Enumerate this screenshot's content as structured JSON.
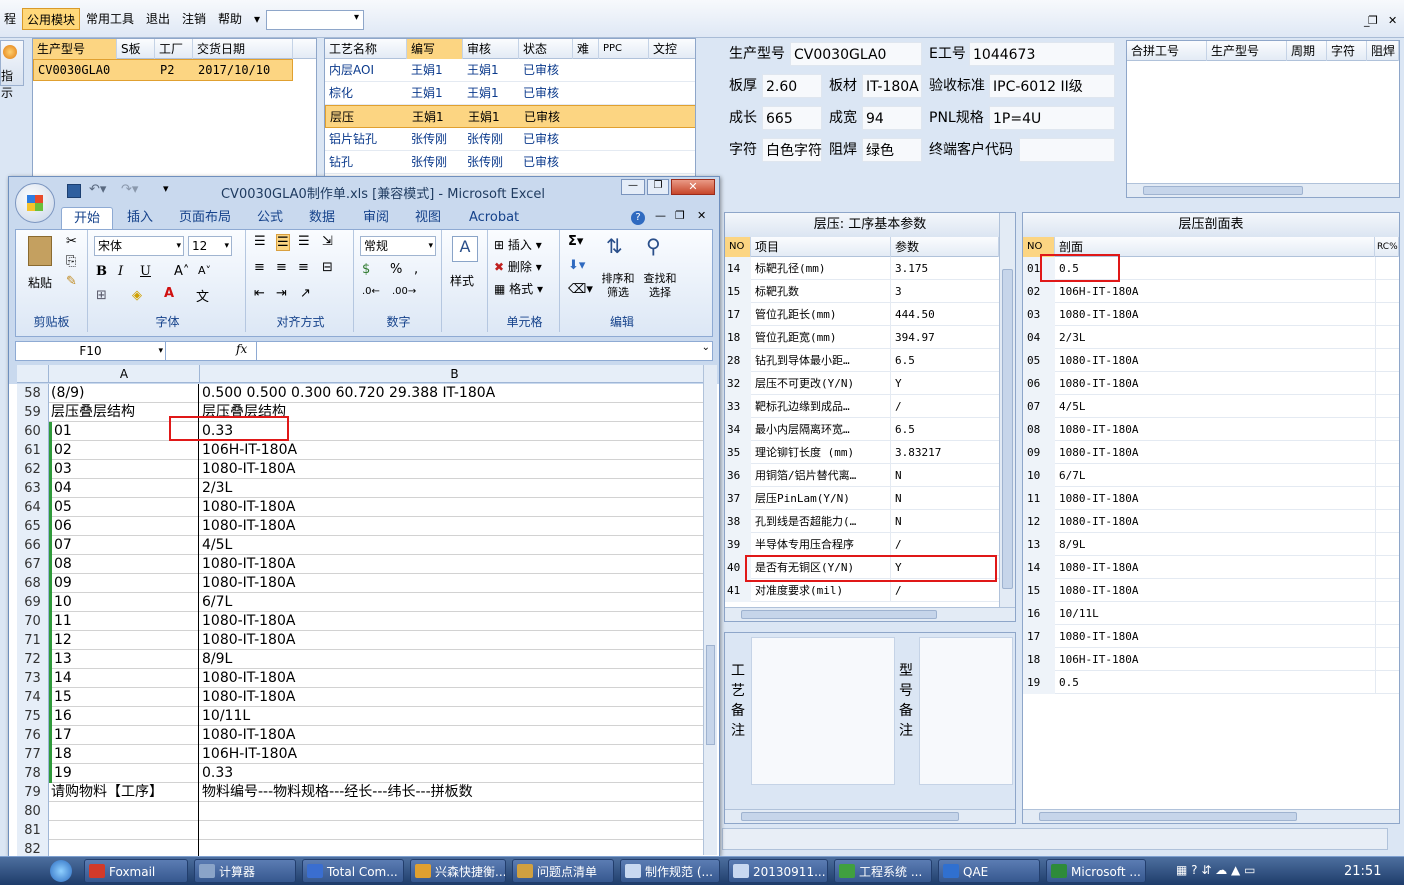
{
  "menu": {
    "items": [
      {
        "label": "程"
      },
      {
        "label": "公用模块"
      },
      {
        "label": "常用工具"
      },
      {
        "label": "退出"
      },
      {
        "label": "注销"
      },
      {
        "label": "帮助"
      }
    ],
    "combo_value": ""
  },
  "left_button_label": "指示",
  "product_table": {
    "headers": [
      "生产型号",
      "S板",
      "工厂",
      "交货日期"
    ],
    "rows": [
      [
        "CV0030GLA0",
        "",
        "P2",
        "2017/10/10"
      ]
    ]
  },
  "process_table": {
    "headers": [
      "工艺名称",
      "编写",
      "审核",
      "状态",
      "难",
      "PPC",
      "文控"
    ],
    "rows": [
      [
        "内层AOI",
        "王娟1",
        "王娟1",
        "已审核"
      ],
      [
        "棕化",
        "王娟1",
        "王娟1",
        "已审核"
      ],
      [
        "层压",
        "王娟1",
        "王娟1",
        "已审核"
      ],
      [
        "铝片钻孔",
        "张传刚",
        "张传刚",
        "已审核"
      ],
      [
        "钻孔",
        "张传刚",
        "张传刚",
        "已审核"
      ]
    ],
    "selected_row": 2
  },
  "info": {
    "model_label": "生产型号",
    "model_value": "CV0030GLA0",
    "eno_label": "E工号",
    "eno_value": "1044673",
    "thick_label": "板厚",
    "thick_value": "2.60",
    "material_label": "板材",
    "material_value": "IT-180A",
    "standard_label": "验收标准",
    "standard_value": "IPC-6012 II级",
    "length_label": "成长",
    "length_value": "665",
    "width_label": "成宽",
    "width_value": "94",
    "pnl_label": "PNL规格",
    "pnl_value": "1P=4U",
    "char_label": "字符",
    "char_value": "白色字符",
    "mask_label": "阻焊",
    "mask_value": "绿色",
    "customer_label": "终端客户代码",
    "customer_value": ""
  },
  "merge_table": {
    "headers": [
      "合拼工号",
      "生产型号",
      "周期",
      "字符",
      "阻焊"
    ]
  },
  "params_panel": {
    "title": "层压: 工序基本参数",
    "headers": [
      "NO",
      "项目",
      "参数"
    ],
    "rows": [
      [
        "14",
        "标靶孔径(mm)",
        "3.175"
      ],
      [
        "15",
        "标靶孔数",
        "3"
      ],
      [
        "17",
        "管位孔距长(mm)",
        "444.50"
      ],
      [
        "18",
        "管位孔距宽(mm)",
        "394.97"
      ],
      [
        "28",
        "钻孔到导体最小距…",
        "6.5"
      ],
      [
        "32",
        "层压不可更改(Y/N)",
        "Y"
      ],
      [
        "33",
        "靶标孔边缘到成品…",
        "/"
      ],
      [
        "34",
        "最小内层隔离环宽…",
        "6.5"
      ],
      [
        "35",
        "理论铆钉长度 (mm)",
        "3.83217"
      ],
      [
        "36",
        "用铜箔/铝片替代离…",
        "N"
      ],
      [
        "37",
        "层压PinLam(Y/N)",
        "N"
      ],
      [
        "38",
        "孔到线是否超能力(…",
        "N"
      ],
      [
        "39",
        "半导体专用压合程序",
        "/"
      ],
      [
        "40",
        "是否有无铜区(Y/N)",
        "Y"
      ],
      [
        "41",
        "对准度要求(mil)",
        "/"
      ]
    ]
  },
  "notes": {
    "process_label": "工艺备注",
    "model_label": "型号备注"
  },
  "stack_panel": {
    "title": "层压剖面表",
    "headers": [
      "NO",
      "剖面",
      "RC%"
    ],
    "rows": [
      [
        "01",
        "0.5"
      ],
      [
        "02",
        "106H-IT-180A"
      ],
      [
        "03",
        "1080-IT-180A"
      ],
      [
        "04",
        "2/3L"
      ],
      [
        "05",
        "1080-IT-180A"
      ],
      [
        "06",
        "1080-IT-180A"
      ],
      [
        "07",
        "4/5L"
      ],
      [
        "08",
        "1080-IT-180A"
      ],
      [
        "09",
        "1080-IT-180A"
      ],
      [
        "10",
        "6/7L"
      ],
      [
        "11",
        "1080-IT-180A"
      ],
      [
        "12",
        "1080-IT-180A"
      ],
      [
        "13",
        "8/9L"
      ],
      [
        "14",
        "1080-IT-180A"
      ],
      [
        "15",
        "1080-IT-180A"
      ],
      [
        "16",
        "10/11L"
      ],
      [
        "17",
        "1080-IT-180A"
      ],
      [
        "18",
        "106H-IT-180A"
      ],
      [
        "19",
        "0.5"
      ]
    ]
  },
  "excel": {
    "title": "CV0030GLA0制作单.xls  [兼容模式] - Microsoft Excel",
    "tabs": [
      "开始",
      "插入",
      "页面布局",
      "公式",
      "数据",
      "审阅",
      "视图",
      "Acrobat"
    ],
    "font_name": "宋体",
    "font_size": "12",
    "number_format": "常规",
    "groups": {
      "clipboard": "剪贴板",
      "font": "字体",
      "align": "对齐方式",
      "number": "数字",
      "cells": "单元格",
      "edit": "编辑"
    },
    "paste_label": "粘贴",
    "styles_label": "样式",
    "insert_label": "插入",
    "delete_label": "删除",
    "format_label": "格式",
    "sort_label": "排序和筛选",
    "find_label": "查找和选择",
    "name_box": "F10",
    "col_a": "A",
    "col_b": "B",
    "rows": [
      {
        "n": "58",
        "a": "(8/9)",
        "b": "0.500  0.500          0.300       60.720     29.388       IT-180A"
      },
      {
        "n": "59",
        "a": "层压叠层结构",
        "b": "层压叠层结构"
      },
      {
        "n": "60",
        "a": "01",
        "b": "0.33"
      },
      {
        "n": "61",
        "a": "02",
        "b": "106H-IT-180A"
      },
      {
        "n": "62",
        "a": "03",
        "b": "1080-IT-180A"
      },
      {
        "n": "63",
        "a": "04",
        "b": "2/3L"
      },
      {
        "n": "64",
        "a": "05",
        "b": "1080-IT-180A"
      },
      {
        "n": "65",
        "a": "06",
        "b": "1080-IT-180A"
      },
      {
        "n": "66",
        "a": "07",
        "b": "4/5L"
      },
      {
        "n": "67",
        "a": "08",
        "b": "1080-IT-180A"
      },
      {
        "n": "68",
        "a": "09",
        "b": "1080-IT-180A"
      },
      {
        "n": "69",
        "a": "10",
        "b": "6/7L"
      },
      {
        "n": "70",
        "a": "11",
        "b": "1080-IT-180A"
      },
      {
        "n": "71",
        "a": "12",
        "b": "1080-IT-180A"
      },
      {
        "n": "72",
        "a": "13",
        "b": "8/9L"
      },
      {
        "n": "73",
        "a": "14",
        "b": "1080-IT-180A"
      },
      {
        "n": "74",
        "a": "15",
        "b": "1080-IT-180A"
      },
      {
        "n": "75",
        "a": "16",
        "b": "10/11L"
      },
      {
        "n": "76",
        "a": "17",
        "b": "1080-IT-180A"
      },
      {
        "n": "77",
        "a": "18",
        "b": "106H-IT-180A"
      },
      {
        "n": "78",
        "a": "19",
        "b": "0.33"
      },
      {
        "n": "79",
        "a": "请购物料【工序】",
        "b": "物料编号---物料规格---经长---纬长---拼板数"
      },
      {
        "n": "80",
        "a": "",
        "b": ""
      },
      {
        "n": "81",
        "a": "",
        "b": ""
      },
      {
        "n": "82",
        "a": "",
        "b": ""
      }
    ]
  },
  "taskbar": {
    "buttons": [
      {
        "label": "Foxmail",
        "icon": "foxmail-icon",
        "color": "#d23a2a"
      },
      {
        "label": "计算器",
        "icon": "calculator-icon",
        "color": "#8aa4c8"
      },
      {
        "label": "Total Com...",
        "icon": "floppy-icon",
        "color": "#3a6ed0"
      },
      {
        "label": "兴森快捷衡...",
        "icon": "star-icon",
        "color": "#e0a030"
      },
      {
        "label": "问题点清单",
        "icon": "grid-icon",
        "color": "#d0a040"
      },
      {
        "label": "制作规范 (...",
        "icon": "document-icon",
        "color": "#c8d8f0"
      },
      {
        "label": "20130911...",
        "icon": "document-icon",
        "color": "#c8d8f0"
      },
      {
        "label": "工程系统 ...",
        "icon": "app-icon",
        "color": "#40a040"
      },
      {
        "label": "QAE",
        "icon": "app-icon",
        "color": "#3070d0"
      },
      {
        "label": "Microsoft ...",
        "icon": "excel-icon",
        "color": "#2e8b3a"
      }
    ],
    "clock": "21:51"
  }
}
